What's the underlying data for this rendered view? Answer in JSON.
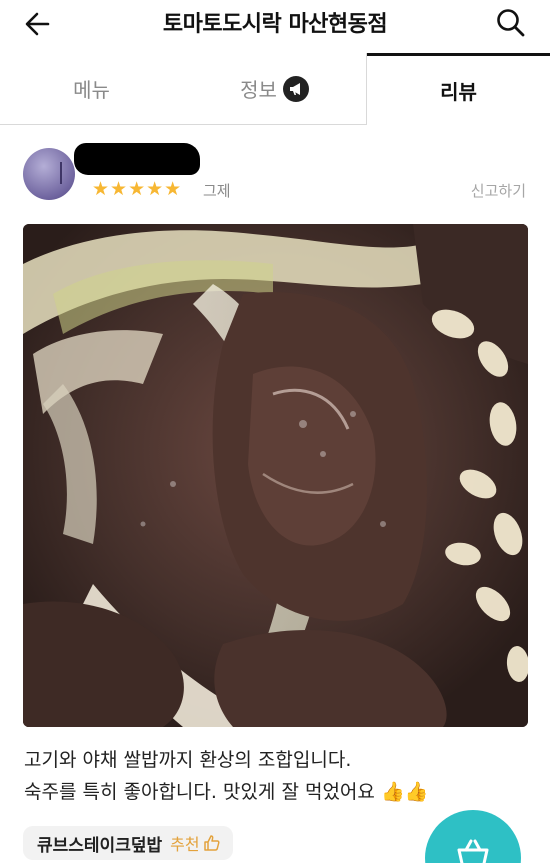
{
  "header": {
    "title": "토마토도시락 마산현동점",
    "back_icon": "arrow-left-icon",
    "search_icon": "search-icon"
  },
  "tabs": [
    {
      "label": "메뉴",
      "active": false
    },
    {
      "label": "정보",
      "active": false,
      "icon": "megaphone-icon"
    },
    {
      "label": "리뷰",
      "active": true
    }
  ],
  "review": {
    "stars": "★★★★★",
    "rating": 5,
    "date": "그제",
    "report_label": "신고하기",
    "text_line1": "고기와 야채 쌀밥까지 환상의 조합입니다.",
    "text_line2": "숙주를 특히 좋아합니다. 맛있게 잘 먹었어요",
    "thumbs": "👍👍",
    "menu_name": "큐브스테이크덮밥",
    "recommend_label": "추천"
  },
  "colors": {
    "star": "#f7b733",
    "accent_teal": "#2ec0c5",
    "recommend": "#e3a23c"
  }
}
